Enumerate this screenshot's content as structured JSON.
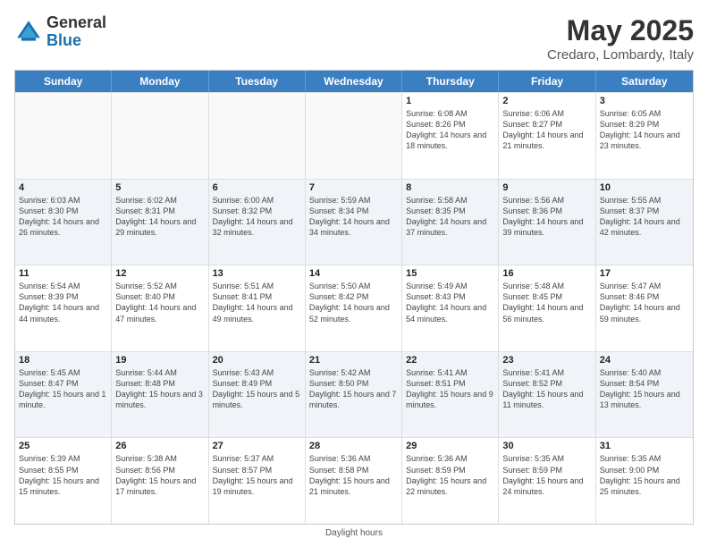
{
  "logo": {
    "general": "General",
    "blue": "Blue"
  },
  "title": {
    "month": "May 2025",
    "location": "Credaro, Lombardy, Italy"
  },
  "header_days": [
    "Sunday",
    "Monday",
    "Tuesday",
    "Wednesday",
    "Thursday",
    "Friday",
    "Saturday"
  ],
  "footer": "Daylight hours",
  "weeks": [
    [
      {
        "day": "",
        "info": "",
        "empty": true
      },
      {
        "day": "",
        "info": "",
        "empty": true
      },
      {
        "day": "",
        "info": "",
        "empty": true
      },
      {
        "day": "",
        "info": "",
        "empty": true
      },
      {
        "day": "1",
        "info": "Sunrise: 6:08 AM\nSunset: 8:26 PM\nDaylight: 14 hours and 18 minutes.",
        "empty": false
      },
      {
        "day": "2",
        "info": "Sunrise: 6:06 AM\nSunset: 8:27 PM\nDaylight: 14 hours and 21 minutes.",
        "empty": false
      },
      {
        "day": "3",
        "info": "Sunrise: 6:05 AM\nSunset: 8:29 PM\nDaylight: 14 hours and 23 minutes.",
        "empty": false
      }
    ],
    [
      {
        "day": "4",
        "info": "Sunrise: 6:03 AM\nSunset: 8:30 PM\nDaylight: 14 hours and 26 minutes.",
        "empty": false
      },
      {
        "day": "5",
        "info": "Sunrise: 6:02 AM\nSunset: 8:31 PM\nDaylight: 14 hours and 29 minutes.",
        "empty": false
      },
      {
        "day": "6",
        "info": "Sunrise: 6:00 AM\nSunset: 8:32 PM\nDaylight: 14 hours and 32 minutes.",
        "empty": false
      },
      {
        "day": "7",
        "info": "Sunrise: 5:59 AM\nSunset: 8:34 PM\nDaylight: 14 hours and 34 minutes.",
        "empty": false
      },
      {
        "day": "8",
        "info": "Sunrise: 5:58 AM\nSunset: 8:35 PM\nDaylight: 14 hours and 37 minutes.",
        "empty": false
      },
      {
        "day": "9",
        "info": "Sunrise: 5:56 AM\nSunset: 8:36 PM\nDaylight: 14 hours and 39 minutes.",
        "empty": false
      },
      {
        "day": "10",
        "info": "Sunrise: 5:55 AM\nSunset: 8:37 PM\nDaylight: 14 hours and 42 minutes.",
        "empty": false
      }
    ],
    [
      {
        "day": "11",
        "info": "Sunrise: 5:54 AM\nSunset: 8:39 PM\nDaylight: 14 hours and 44 minutes.",
        "empty": false
      },
      {
        "day": "12",
        "info": "Sunrise: 5:52 AM\nSunset: 8:40 PM\nDaylight: 14 hours and 47 minutes.",
        "empty": false
      },
      {
        "day": "13",
        "info": "Sunrise: 5:51 AM\nSunset: 8:41 PM\nDaylight: 14 hours and 49 minutes.",
        "empty": false
      },
      {
        "day": "14",
        "info": "Sunrise: 5:50 AM\nSunset: 8:42 PM\nDaylight: 14 hours and 52 minutes.",
        "empty": false
      },
      {
        "day": "15",
        "info": "Sunrise: 5:49 AM\nSunset: 8:43 PM\nDaylight: 14 hours and 54 minutes.",
        "empty": false
      },
      {
        "day": "16",
        "info": "Sunrise: 5:48 AM\nSunset: 8:45 PM\nDaylight: 14 hours and 56 minutes.",
        "empty": false
      },
      {
        "day": "17",
        "info": "Sunrise: 5:47 AM\nSunset: 8:46 PM\nDaylight: 14 hours and 59 minutes.",
        "empty": false
      }
    ],
    [
      {
        "day": "18",
        "info": "Sunrise: 5:45 AM\nSunset: 8:47 PM\nDaylight: 15 hours and 1 minute.",
        "empty": false
      },
      {
        "day": "19",
        "info": "Sunrise: 5:44 AM\nSunset: 8:48 PM\nDaylight: 15 hours and 3 minutes.",
        "empty": false
      },
      {
        "day": "20",
        "info": "Sunrise: 5:43 AM\nSunset: 8:49 PM\nDaylight: 15 hours and 5 minutes.",
        "empty": false
      },
      {
        "day": "21",
        "info": "Sunrise: 5:42 AM\nSunset: 8:50 PM\nDaylight: 15 hours and 7 minutes.",
        "empty": false
      },
      {
        "day": "22",
        "info": "Sunrise: 5:41 AM\nSunset: 8:51 PM\nDaylight: 15 hours and 9 minutes.",
        "empty": false
      },
      {
        "day": "23",
        "info": "Sunrise: 5:41 AM\nSunset: 8:52 PM\nDaylight: 15 hours and 11 minutes.",
        "empty": false
      },
      {
        "day": "24",
        "info": "Sunrise: 5:40 AM\nSunset: 8:54 PM\nDaylight: 15 hours and 13 minutes.",
        "empty": false
      }
    ],
    [
      {
        "day": "25",
        "info": "Sunrise: 5:39 AM\nSunset: 8:55 PM\nDaylight: 15 hours and 15 minutes.",
        "empty": false
      },
      {
        "day": "26",
        "info": "Sunrise: 5:38 AM\nSunset: 8:56 PM\nDaylight: 15 hours and 17 minutes.",
        "empty": false
      },
      {
        "day": "27",
        "info": "Sunrise: 5:37 AM\nSunset: 8:57 PM\nDaylight: 15 hours and 19 minutes.",
        "empty": false
      },
      {
        "day": "28",
        "info": "Sunrise: 5:36 AM\nSunset: 8:58 PM\nDaylight: 15 hours and 21 minutes.",
        "empty": false
      },
      {
        "day": "29",
        "info": "Sunrise: 5:36 AM\nSunset: 8:59 PM\nDaylight: 15 hours and 22 minutes.",
        "empty": false
      },
      {
        "day": "30",
        "info": "Sunrise: 5:35 AM\nSunset: 8:59 PM\nDaylight: 15 hours and 24 minutes.",
        "empty": false
      },
      {
        "day": "31",
        "info": "Sunrise: 5:35 AM\nSunset: 9:00 PM\nDaylight: 15 hours and 25 minutes.",
        "empty": false
      }
    ]
  ]
}
